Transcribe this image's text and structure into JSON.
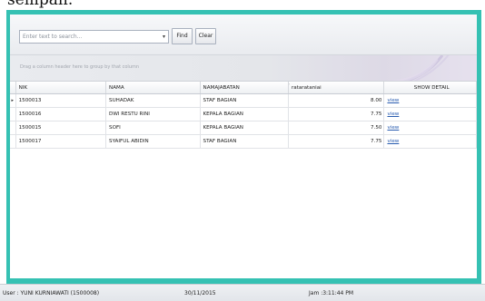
{
  "top_text": "sempan.",
  "search": {
    "placeholder": "Enter text to search...",
    "find_label": "Find",
    "clear_label": "Clear"
  },
  "groupbar": {
    "text": "Drag a column header here to group by that column"
  },
  "grid": {
    "columns": [
      "NIK",
      "NAMA",
      "NAMAJABATAN",
      "ratarataniai",
      "SHOW DETAIL"
    ],
    "rows": [
      {
        "indicator": "▸",
        "nik": "1500013",
        "nama": "SUHADAK",
        "jabatan": "STAF BAGIAN",
        "rata": "8.00",
        "detail": "view"
      },
      {
        "indicator": "",
        "nik": "1500016",
        "nama": "DWI RESTU RINI",
        "jabatan": "KEPALA BAGIAN",
        "rata": "7.75",
        "detail": "view"
      },
      {
        "indicator": "",
        "nik": "1500015",
        "nama": "SOFI",
        "jabatan": "KEPALA BAGIAN",
        "rata": "7.50",
        "detail": "view"
      },
      {
        "indicator": "",
        "nik": "1500017",
        "nama": "SYAIFUL ABIDIN",
        "jabatan": "STAF BAGIAN",
        "rata": "7.75",
        "detail": "view"
      }
    ]
  },
  "status": {
    "user": "User : YUNI KURNIAWATI (1500008)",
    "date": "30/11/2015",
    "time": "Jam :3:11:44 PM"
  },
  "colors": {
    "frame": "#35c1b3",
    "link": "#2a5db0"
  }
}
